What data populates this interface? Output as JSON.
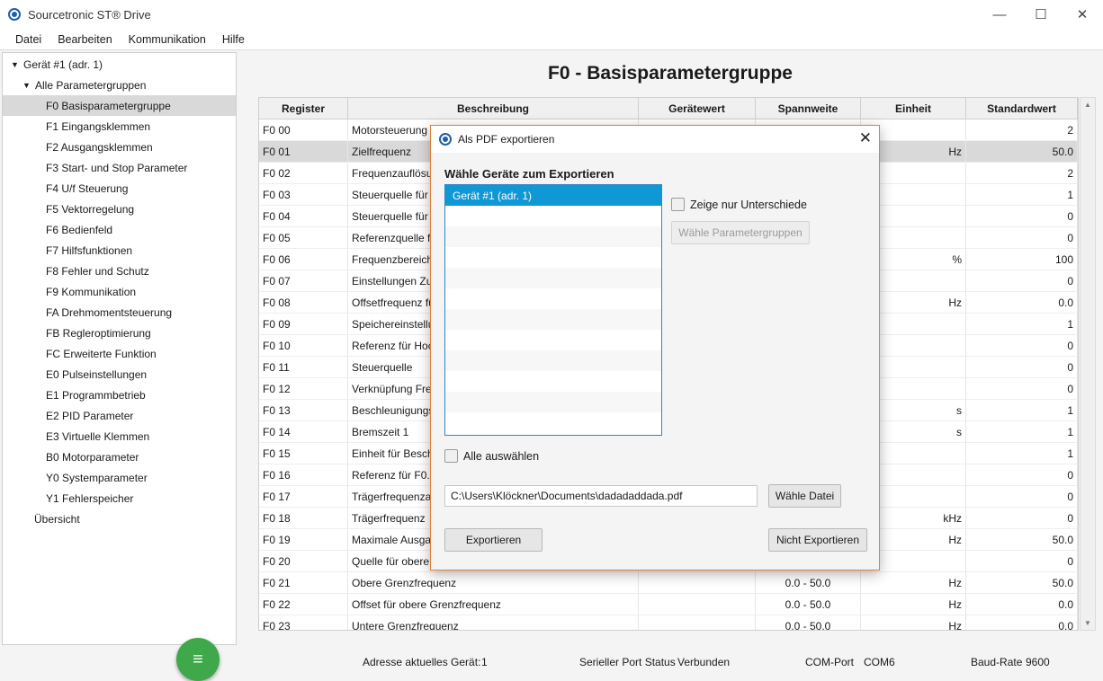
{
  "window": {
    "title": "Sourcetronic ST® Drive",
    "minimize": "—",
    "maximize": "☐",
    "close": "✕"
  },
  "menu": [
    "Datei",
    "Bearbeiten",
    "Kommunikation",
    "Hilfe"
  ],
  "tree": {
    "root": "Gerät #1 (adr. 1)",
    "group": "Alle Parametergruppen",
    "items": [
      "F0 Basisparametergruppe",
      "F1 Eingangsklemmen",
      "F2 Ausgangsklemmen",
      "F3 Start- und Stop Parameter",
      "F4 U/f Steuerung",
      "F5 Vektorregelung",
      "F6 Bedienfeld",
      "F7 Hilfsfunktionen",
      "F8 Fehler und Schutz",
      "F9 Kommunikation",
      "FA Drehmomentsteuerung",
      "FB Regleroptimierung",
      "FC Erweiterte Funktion",
      "E0 Pulseinstellungen",
      "E1 Programmbetrieb",
      "E2 PID Parameter",
      "E3 Virtuelle Klemmen",
      "B0 Motorparameter",
      "Y0 Systemparameter",
      "Y1 Fehlerspeicher"
    ],
    "selected_index": 0,
    "overview": "Übersicht",
    "fab_icon": "≡"
  },
  "main": {
    "title": "F0 - Basisparametergruppe",
    "columns": [
      "Register",
      "Beschreibung",
      "Gerätewert",
      "Spannweite",
      "Einheit",
      "Standardwert"
    ],
    "rows": [
      [
        "F0 00",
        "Motorsteuerung",
        "",
        "",
        "",
        "2"
      ],
      [
        "F0 01",
        "Zielfrequenz",
        "",
        "",
        "Hz",
        "50.0"
      ],
      [
        "F0 02",
        "Frequenzauflösu",
        "",
        "",
        "",
        "2"
      ],
      [
        "F0 03",
        "Steuerquelle für",
        "",
        "",
        "",
        "1"
      ],
      [
        "F0 04",
        "Steuerquelle für",
        "",
        "",
        "",
        "0"
      ],
      [
        "F0 05",
        "Referenzquelle fü",
        "",
        "",
        "",
        "0"
      ],
      [
        "F0 06",
        "Frequenzbereich",
        "",
        "",
        "%",
        "100"
      ],
      [
        "F0 07",
        "Einstellungen Zu",
        "",
        "",
        "",
        "0"
      ],
      [
        "F0 08",
        "Offsetfrequenz fü",
        "",
        "",
        "Hz",
        "0.0"
      ],
      [
        "F0 09",
        "Speichereinstellu",
        "",
        "",
        "",
        "1"
      ],
      [
        "F0 10",
        "Referenz für Hoc",
        "",
        "",
        "",
        "0"
      ],
      [
        "F0 11",
        "Steuerquelle",
        "",
        "",
        "",
        "0"
      ],
      [
        "F0 12",
        "Verknüpfung Fre",
        "",
        "",
        "",
        "0"
      ],
      [
        "F0 13",
        "Beschleunigungs",
        "",
        "",
        "s",
        "1"
      ],
      [
        "F0 14",
        "Bremszeit 1",
        "",
        "",
        "s",
        "1"
      ],
      [
        "F0 15",
        "Einheit für Besch",
        "",
        "",
        "",
        "1"
      ],
      [
        "F0 16",
        "Referenz für F0.1",
        "",
        "",
        "",
        "0"
      ],
      [
        "F0 17",
        "Trägerfrequenza",
        "",
        "",
        "",
        "0"
      ],
      [
        "F0 18",
        "Trägerfrequenz",
        "",
        "",
        "kHz",
        "0"
      ],
      [
        "F0 19",
        "Maximale Ausga",
        "",
        "",
        "Hz",
        "50.0"
      ],
      [
        "F0 20",
        "Quelle für obere",
        "",
        "",
        "",
        "0"
      ],
      [
        "F0 21",
        "Obere Grenzfrequenz",
        "",
        "0.0 - 50.0",
        "Hz",
        "50.0"
      ],
      [
        "F0 22",
        "Offset für obere Grenzfrequenz",
        "",
        "0.0 - 50.0",
        "Hz",
        "0.0"
      ],
      [
        "F0 23",
        "Untere Grenzfrequenz",
        "",
        "0.0 - 50.0",
        "Hz",
        "0.0"
      ]
    ],
    "selected_row": 1
  },
  "status": {
    "address_label": "Adresse aktuelles Gerät:",
    "address_value": "1",
    "port_label": "Serieller Port Status",
    "port_value": "Verbunden",
    "com_label": "COM-Port",
    "com_value": "COM6",
    "baud_label": "Baud-Rate",
    "baud_value": "9600"
  },
  "dialog": {
    "title": "Als PDF exportieren",
    "heading": "Wähle Geräte zum Exportieren",
    "devices": [
      "Gerät #1 (adr. 1)"
    ],
    "only_diff_label": "Zeige nur Unterschiede",
    "only_diff_checked": false,
    "choose_groups_label": "Wähle Parametergruppen",
    "select_all_label": "Alle auswählen",
    "select_all_checked": false,
    "file_path": "C:\\Users\\Klöckner\\Documents\\dadadaddada.pdf",
    "choose_file_label": "Wähle Datei",
    "export_label": "Exportieren",
    "cancel_label": "Nicht Exportieren"
  },
  "colors": {
    "accent": "#0f97d6",
    "fab": "#3ea84a",
    "dialog_border": "#e0803a"
  }
}
